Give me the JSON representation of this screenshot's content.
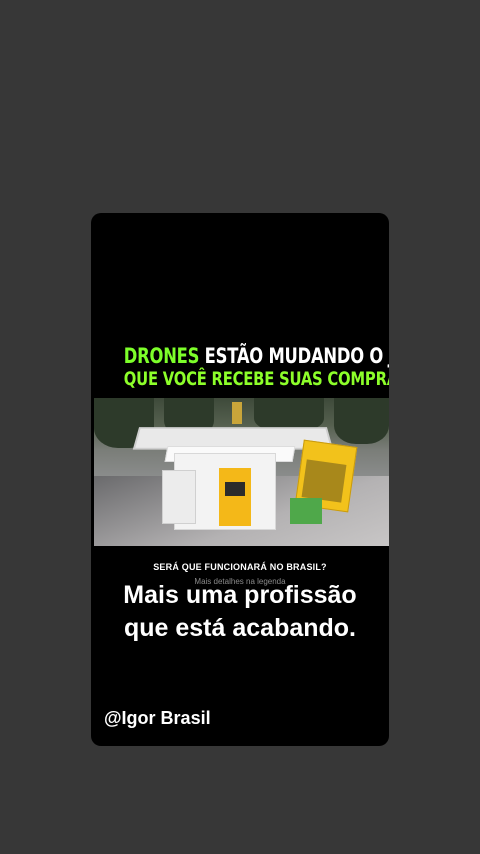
{
  "story": {
    "headline_highlight": "DRONES",
    "headline_rest": " ESTÃO MUDANDO O JEITO",
    "headline_line2": "QUE VOCÊ RECEBE SUAS COMPRAS!",
    "question": "SERÁ QUE FUNCIONARÁ NO BRASIL?",
    "details": "Mais detalhes na legenda",
    "caption_line1": "Mais uma profissão",
    "caption_line2": "que está acabando.",
    "handle": "@Igor Brasil"
  },
  "colors": {
    "background": "#373737",
    "card": "#000000",
    "accent_green": "#7dff2a",
    "kiosk_yellow": "#f4b818"
  }
}
